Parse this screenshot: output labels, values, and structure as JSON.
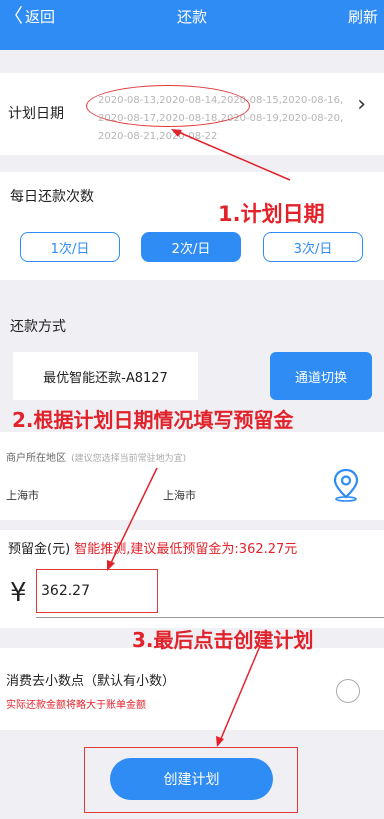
{
  "header": {
    "back_label": "返回",
    "title": "还款",
    "refresh_label": "刷新"
  },
  "plan_dates": {
    "label": "计划日期",
    "value": "2020-08-13,2020-08-14,2020-08-15,2020-08-16,2020-08-17,2020-08-18,2020-08-19,2020-08-20,2020-08-21,2020-08-22"
  },
  "daily_count": {
    "label": "每日还款次数",
    "options": [
      "1次/日",
      "2次/日",
      "3次/日"
    ],
    "selected": "2次/日"
  },
  "repay_method": {
    "label": "还款方式",
    "channel": "最优智能还款-A8127",
    "switch_label": "通道切换"
  },
  "region": {
    "label": "商户所在地区",
    "hint": "(建议您选择当前常驻地为宜)",
    "province": "上海市",
    "city": "上海市"
  },
  "reserve": {
    "label": "预留金(元)",
    "hint": "智能推测,建议最低预留金为:362.27元",
    "currency": "¥",
    "value": "362.27"
  },
  "decimal_option": {
    "label": "消费去小数点（默认有小数）",
    "note": "实际还款金额将略大于账单金额"
  },
  "create_button": "创建计划",
  "annotations": {
    "step1": "1.计划日期",
    "step2": "2.根据计划日期情况填写预留金",
    "step3": "3.最后点击创建计划"
  },
  "colors": {
    "primary": "#2f8cf5",
    "annotation": "#e2222a",
    "background": "#efeff4"
  }
}
